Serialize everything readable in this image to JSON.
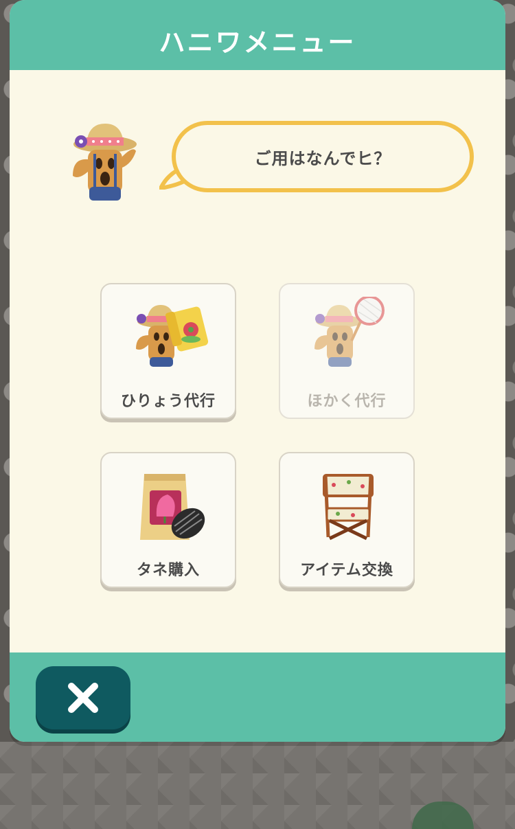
{
  "header": {
    "title": "ハニワメニュー"
  },
  "dialog": {
    "message": "ご用はなんでヒ？"
  },
  "menu": {
    "items": [
      {
        "label": "ひりょう代行",
        "icon": "haniwa-fertilizer-icon",
        "enabled": true
      },
      {
        "label": "ほかく代行",
        "icon": "haniwa-bug-net-icon",
        "enabled": false
      },
      {
        "label": "タネ購入",
        "icon": "seed-packet-icon",
        "enabled": true
      },
      {
        "label": "アイテム交換",
        "icon": "folding-chair-icon",
        "enabled": true
      }
    ]
  },
  "footer": {
    "close_icon": "close-icon"
  },
  "colors": {
    "header": "#5cbfa7",
    "panel": "#fbf8e7",
    "bubble_border": "#f2c14b",
    "close_button": "#0f5a60"
  }
}
